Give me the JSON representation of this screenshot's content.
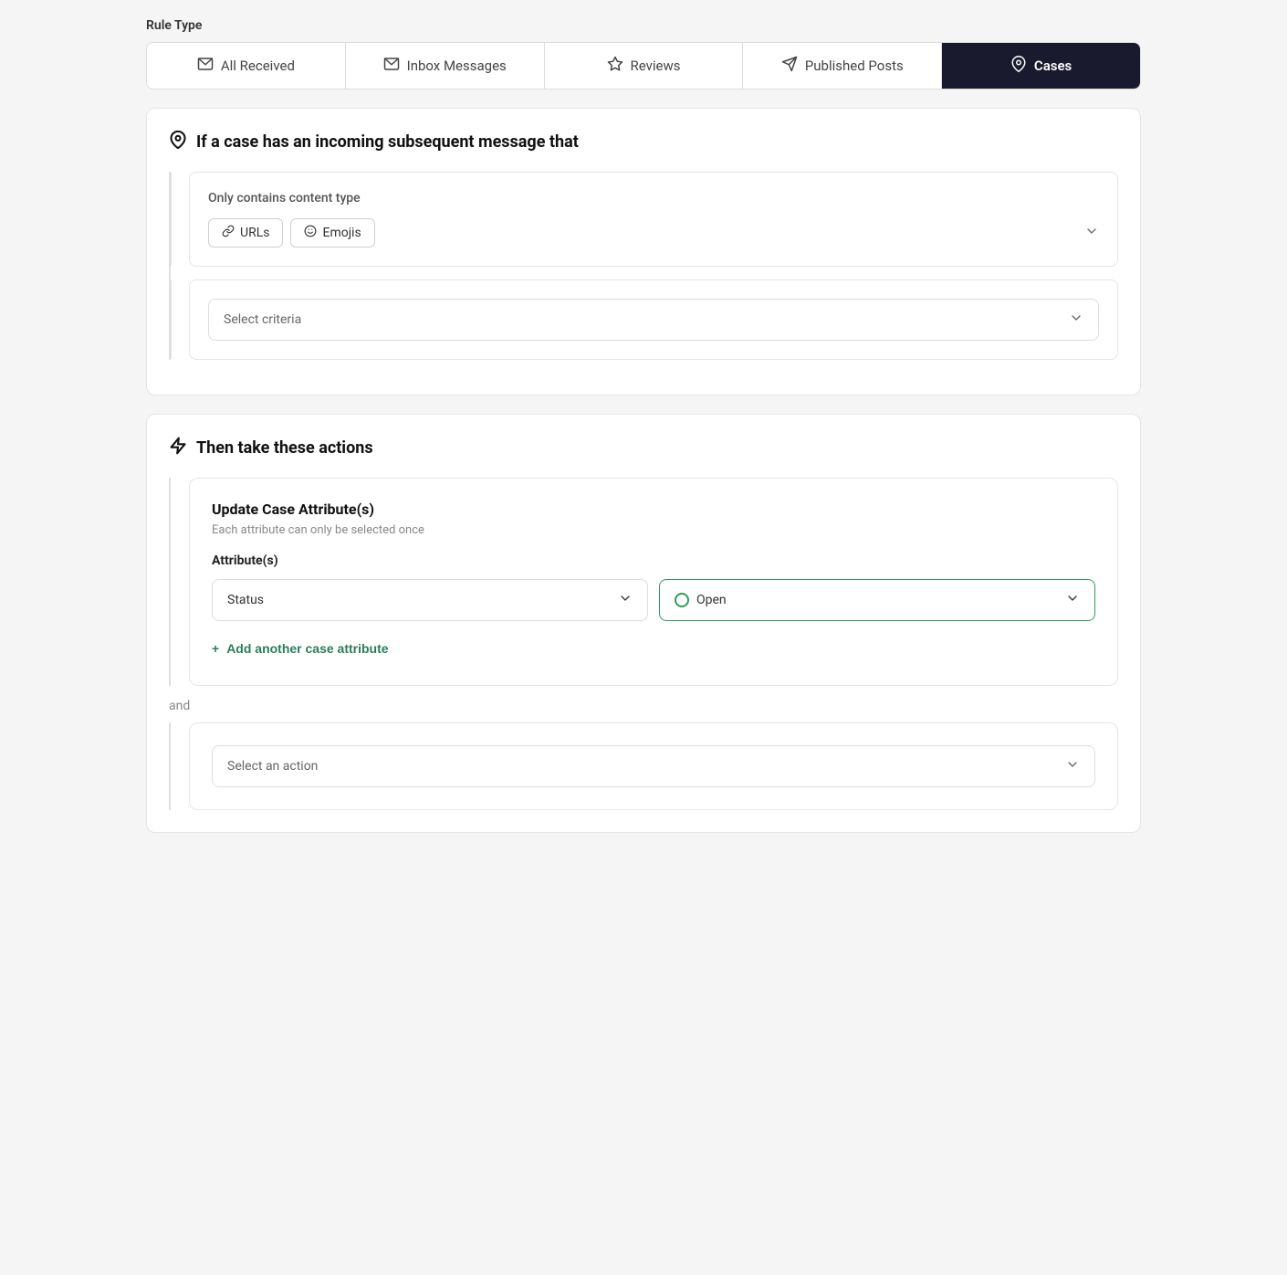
{
  "ruleType": {
    "label": "Rule Type",
    "tabs": [
      {
        "id": "all-received",
        "label": "All Received",
        "icon": "✉",
        "active": false
      },
      {
        "id": "inbox-messages",
        "label": "Inbox Messages",
        "icon": "✉",
        "active": false
      },
      {
        "id": "reviews",
        "label": "Reviews",
        "icon": "☆",
        "active": false
      },
      {
        "id": "published-posts",
        "label": "Published Posts",
        "icon": "✈",
        "active": false
      },
      {
        "id": "cases",
        "label": "Cases",
        "icon": "📌",
        "active": true
      }
    ]
  },
  "conditionSection": {
    "title": "If a case has an incoming subsequent message that",
    "icon": "📌",
    "conditions": [
      {
        "label": "Only contains content type",
        "tags": [
          {
            "id": "urls",
            "icon": "🔗",
            "label": "URLs"
          },
          {
            "id": "emojis",
            "icon": "😊",
            "label": "Emojis"
          }
        ]
      },
      {
        "placeholder": "Select criteria"
      }
    ]
  },
  "actionSection": {
    "title": "Then take these actions",
    "icon": "⚡",
    "actions": [
      {
        "title": "Update Case Attribute(s)",
        "subtitle": "Each attribute can only be selected once",
        "attributesLabel": "Attribute(s)",
        "attributeDropdown": {
          "value": "Status"
        },
        "valueDropdown": {
          "value": "Open",
          "status": "open"
        },
        "addButtonLabel": "Add another case attribute"
      }
    ],
    "andLabel": "and",
    "selectActionPlaceholder": "Select an action"
  }
}
